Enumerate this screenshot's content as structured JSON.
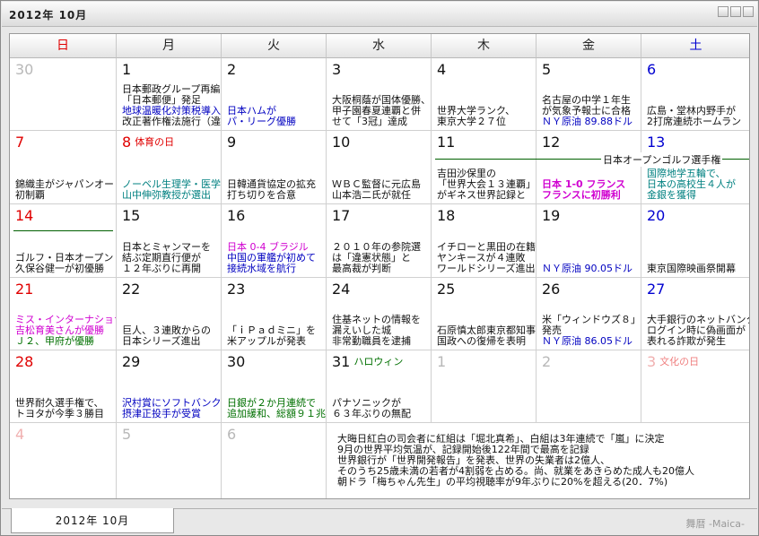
{
  "window": {
    "title": "2012年 10月"
  },
  "weekdays": [
    "日",
    "月",
    "火",
    "水",
    "木",
    "金",
    "土"
  ],
  "weeks": [
    [
      {
        "day": "30",
        "other": true,
        "lines": []
      },
      {
        "day": "1",
        "lines": [
          {
            "t": "日本郵政グループ再編",
            "c": "c-black"
          },
          {
            "t": "「日本郵便」発足",
            "c": "c-black"
          },
          {
            "t": "地球温暖化対策税導入",
            "c": "c-blue"
          },
          {
            "t": "改正著作権法施行（違",
            "c": "c-black"
          }
        ]
      },
      {
        "day": "2",
        "lines": [
          {
            "t": "",
            "c": ""
          },
          {
            "t": "",
            "c": ""
          },
          {
            "t": "日本ハムが",
            "c": "c-blue"
          },
          {
            "t": "パ・リーグ優勝",
            "c": "c-blue"
          }
        ]
      },
      {
        "day": "3",
        "lines": [
          {
            "t": "",
            "c": ""
          },
          {
            "t": "大阪桐蔭が国体優勝、",
            "c": "c-black"
          },
          {
            "t": "甲子園春夏連覇と併",
            "c": "c-black"
          },
          {
            "t": "せて「3冠」達成",
            "c": "c-black"
          }
        ]
      },
      {
        "day": "4",
        "lines": [
          {
            "t": "",
            "c": ""
          },
          {
            "t": "",
            "c": ""
          },
          {
            "t": "世界大学ランク、",
            "c": "c-black"
          },
          {
            "t": "東京大学２７位",
            "c": "c-black"
          }
        ]
      },
      {
        "day": "5",
        "lines": [
          {
            "t": "",
            "c": ""
          },
          {
            "t": "名古屋の中学１年生",
            "c": "c-black"
          },
          {
            "t": "が気象予報士に合格",
            "c": "c-black"
          },
          {
            "t": "ＮＹ原油 89.88ドル",
            "c": "c-blue"
          }
        ]
      },
      {
        "day": "6",
        "sat": true,
        "lines": [
          {
            "t": "",
            "c": ""
          },
          {
            "t": "",
            "c": ""
          },
          {
            "t": "広島・堂林内野手が",
            "c": "c-black"
          },
          {
            "t": "2打席連続ホームラン",
            "c": "c-black"
          }
        ]
      }
    ],
    [
      {
        "day": "7",
        "sun": true,
        "lines": [
          {
            "t": "",
            "c": ""
          },
          {
            "t": "",
            "c": ""
          },
          {
            "t": "錦織圭がジャパンオー",
            "c": "c-black"
          },
          {
            "t": "初制覇",
            "c": "c-black"
          }
        ]
      },
      {
        "day": "8",
        "sun": true,
        "holiday": "体育の日",
        "lines": [
          {
            "t": "",
            "c": ""
          },
          {
            "t": "",
            "c": ""
          },
          {
            "t": "ノーベル生理学・医学",
            "c": "c-teal"
          },
          {
            "t": "山中伸弥教授が選出",
            "c": "c-teal"
          }
        ]
      },
      {
        "day": "9",
        "lines": [
          {
            "t": "",
            "c": ""
          },
          {
            "t": "",
            "c": ""
          },
          {
            "t": "日韓通貨協定の拡充",
            "c": "c-black"
          },
          {
            "t": "打ち切りを合意",
            "c": "c-black"
          }
        ]
      },
      {
        "day": "10",
        "lines": [
          {
            "t": "",
            "c": ""
          },
          {
            "t": "",
            "c": ""
          },
          {
            "t": "ＷＢＣ監督に元広島",
            "c": "c-black"
          },
          {
            "t": "山本浩二氏が就任",
            "c": "c-black"
          }
        ]
      },
      {
        "day": "11",
        "lines": [
          {
            "t": "",
            "c": ""
          },
          {
            "t": "吉田沙保里の",
            "c": "c-black"
          },
          {
            "t": "「世界大会１３連覇」",
            "c": "c-black"
          },
          {
            "t": "がギネス世界記録と",
            "c": "c-black"
          }
        ]
      },
      {
        "day": "12",
        "lines": [
          {
            "t": "",
            "c": ""
          },
          {
            "t": "",
            "c": ""
          },
          {
            "t": "日本 1-0 フランス",
            "c": "c-bold-magenta"
          },
          {
            "t": "フランスに初勝利",
            "c": "c-bold-magenta"
          }
        ]
      },
      {
        "day": "13",
        "sat": true,
        "lines": [
          {
            "t": "",
            "c": ""
          },
          {
            "t": "国際地学五輪で、",
            "c": "c-teal"
          },
          {
            "t": "日本の高校生４人が",
            "c": "c-teal"
          },
          {
            "t": "金銀を獲得",
            "c": "c-teal"
          }
        ]
      }
    ],
    [
      {
        "day": "14",
        "sun": true,
        "lines": [
          {
            "t": "",
            "c": ""
          },
          {
            "t": "",
            "c": ""
          },
          {
            "t": "ゴルフ・日本オープン",
            "c": "c-black"
          },
          {
            "t": "久保谷健一が初優勝",
            "c": "c-black"
          }
        ]
      },
      {
        "day": "15",
        "lines": [
          {
            "t": "",
            "c": ""
          },
          {
            "t": "日本とミャンマーを",
            "c": "c-black"
          },
          {
            "t": "結ぶ定期直行便が",
            "c": "c-black"
          },
          {
            "t": "１２年ぶりに再開",
            "c": "c-black"
          }
        ]
      },
      {
        "day": "16",
        "lines": [
          {
            "t": "",
            "c": ""
          },
          {
            "t": "日本 0-4 ブラジル",
            "c": "c-magenta"
          },
          {
            "t": "中国の軍艦が初めて",
            "c": "c-blue"
          },
          {
            "t": "接続水域を航行",
            "c": "c-blue"
          }
        ]
      },
      {
        "day": "17",
        "lines": [
          {
            "t": "",
            "c": ""
          },
          {
            "t": "２０１０年の参院選",
            "c": "c-black"
          },
          {
            "t": "は「違憲状態」と",
            "c": "c-black"
          },
          {
            "t": "最高裁が判断",
            "c": "c-black"
          }
        ]
      },
      {
        "day": "18",
        "lines": [
          {
            "t": "",
            "c": ""
          },
          {
            "t": "イチローと黒田の在籍",
            "c": "c-black"
          },
          {
            "t": "ヤンキースが４連敗",
            "c": "c-black"
          },
          {
            "t": "ワールドシリーズ進出",
            "c": "c-black"
          }
        ]
      },
      {
        "day": "19",
        "lines": [
          {
            "t": "",
            "c": ""
          },
          {
            "t": "",
            "c": ""
          },
          {
            "t": "",
            "c": ""
          },
          {
            "t": "ＮＹ原油 90.05ドル",
            "c": "c-blue"
          }
        ]
      },
      {
        "day": "20",
        "sat": true,
        "lines": [
          {
            "t": "",
            "c": ""
          },
          {
            "t": "",
            "c": ""
          },
          {
            "t": "",
            "c": ""
          },
          {
            "t": "東京国際映画祭開幕",
            "c": "c-black"
          }
        ]
      }
    ],
    [
      {
        "day": "21",
        "sun": true,
        "lines": [
          {
            "t": "",
            "c": ""
          },
          {
            "t": "ミス・インターナショナル",
            "c": "c-magenta"
          },
          {
            "t": "吉松育美さんが優勝",
            "c": "c-magenta"
          },
          {
            "t": "Ｊ２、甲府が優勝",
            "c": "c-green"
          }
        ]
      },
      {
        "day": "22",
        "lines": [
          {
            "t": "",
            "c": ""
          },
          {
            "t": "",
            "c": ""
          },
          {
            "t": "巨人、３連敗からの",
            "c": "c-black"
          },
          {
            "t": "日本シリーズ進出",
            "c": "c-black"
          }
        ]
      },
      {
        "day": "23",
        "lines": [
          {
            "t": "",
            "c": ""
          },
          {
            "t": "",
            "c": ""
          },
          {
            "t": "「ｉＰａｄミニ」を",
            "c": "c-black"
          },
          {
            "t": "米アップルが発表",
            "c": "c-black"
          }
        ]
      },
      {
        "day": "24",
        "lines": [
          {
            "t": "",
            "c": ""
          },
          {
            "t": "住基ネットの情報を",
            "c": "c-black"
          },
          {
            "t": "漏えいした城",
            "c": "c-black"
          },
          {
            "t": "非常勤職員を逮捕",
            "c": "c-black"
          }
        ]
      },
      {
        "day": "25",
        "lines": [
          {
            "t": "",
            "c": ""
          },
          {
            "t": "",
            "c": ""
          },
          {
            "t": "石原慎太郎東京都知事",
            "c": "c-black"
          },
          {
            "t": "国政への復帰を表明",
            "c": "c-black"
          }
        ]
      },
      {
        "day": "26",
        "lines": [
          {
            "t": "",
            "c": ""
          },
          {
            "t": "米「ウィンドウズ８」",
            "c": "c-black"
          },
          {
            "t": "発売",
            "c": "c-black"
          },
          {
            "t": "ＮＹ原油 86.05ドル",
            "c": "c-blue"
          }
        ]
      },
      {
        "day": "27",
        "sat": true,
        "lines": [
          {
            "t": "",
            "c": ""
          },
          {
            "t": "大手銀行のネットバンク",
            "c": "c-black"
          },
          {
            "t": "ログイン時に偽画面が",
            "c": "c-black"
          },
          {
            "t": "表れる詐欺が発生",
            "c": "c-black"
          }
        ]
      }
    ],
    [
      {
        "day": "28",
        "sun": true,
        "lines": [
          {
            "t": "",
            "c": ""
          },
          {
            "t": "",
            "c": ""
          },
          {
            "t": "世界耐久選手権で、",
            "c": "c-black"
          },
          {
            "t": "トヨタが今季３勝目",
            "c": "c-black"
          }
        ]
      },
      {
        "day": "29",
        "lines": [
          {
            "t": "",
            "c": ""
          },
          {
            "t": "",
            "c": ""
          },
          {
            "t": "沢村賞にソフトバンク",
            "c": "c-blue"
          },
          {
            "t": "摂津正投手が受賞",
            "c": "c-blue"
          }
        ]
      },
      {
        "day": "30",
        "lines": [
          {
            "t": "",
            "c": ""
          },
          {
            "t": "",
            "c": ""
          },
          {
            "t": "日銀が２か月連続で",
            "c": "c-green"
          },
          {
            "t": "追加緩和、総額９１兆",
            "c": "c-green"
          }
        ]
      },
      {
        "day": "31",
        "holiday": "ハロウィン",
        "holidayClass": "c-green",
        "lines": [
          {
            "t": "",
            "c": ""
          },
          {
            "t": "",
            "c": ""
          },
          {
            "t": "パナソニックが",
            "c": "c-black"
          },
          {
            "t": "６３年ぶりの無配",
            "c": "c-black"
          }
        ]
      },
      {
        "day": "1",
        "other": true,
        "lines": []
      },
      {
        "day": "2",
        "other": true,
        "lines": []
      },
      {
        "day": "3",
        "other": true,
        "sun": true,
        "holiday": "文化の日",
        "holidayClass": "c-red",
        "lines": []
      }
    ],
    [
      {
        "day": "4",
        "other": true,
        "sun": true,
        "lines": []
      },
      {
        "day": "5",
        "other": true,
        "lines": []
      },
      {
        "day": "6",
        "other": true,
        "lines": []
      }
    ]
  ],
  "spans": [
    {
      "label": "日本オープンゴルフ選手権",
      "week": 1
    },
    {
      "label": "",
      "week": 2
    }
  ],
  "notes": [
    "大晦日紅白の司会者に紅組は「堀北真希」、白組は3年連続で「嵐」に決定",
    "9月の世界平均気温が、記録開始後122年間で最高を記録",
    "世界銀行が「世界開発報告」を発表、世界の失業者は2億人、",
    "そのうち25歳未満の若者が4割弱を占める。尚、就業をあきらめた成人も20億人",
    "朝ドラ「梅ちゃん先生」の平均視聴率が9年ぶりに20%を超える(20．7%)"
  ],
  "footer": {
    "tab_label": "2012年 10月",
    "brand": "舞暦 -Maica-"
  }
}
